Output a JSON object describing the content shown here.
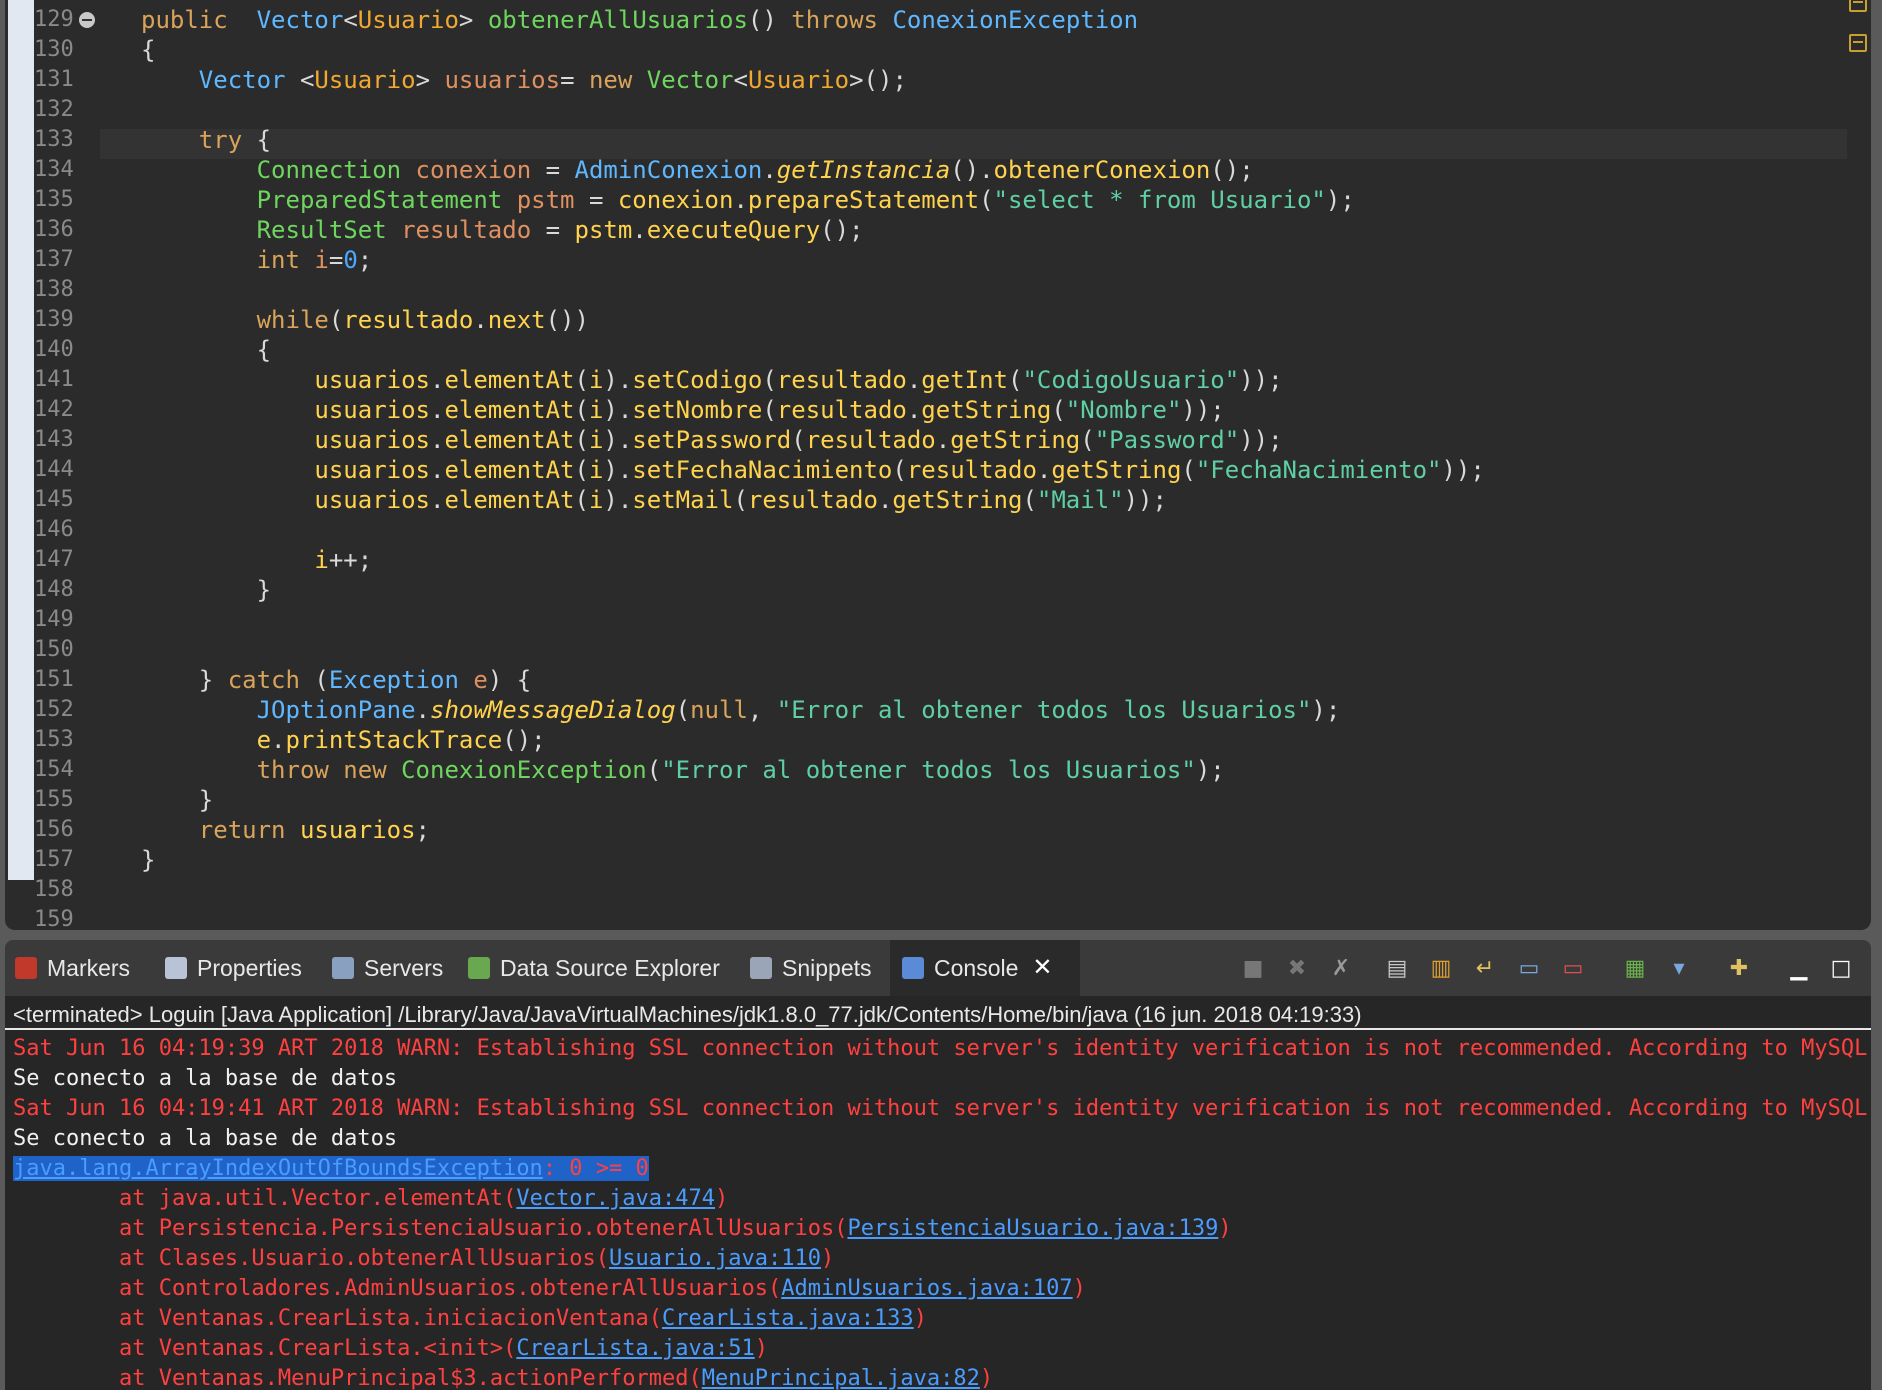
{
  "editor": {
    "line_numbers": [
      "129",
      "130",
      "131",
      "132",
      "133",
      "134",
      "135",
      "136",
      "137",
      "138",
      "139",
      "140",
      "141",
      "142",
      "143",
      "144",
      "145",
      "146",
      "147",
      "148",
      "149",
      "150",
      "151",
      "152",
      "153",
      "154",
      "155",
      "156",
      "157",
      "158",
      "159"
    ],
    "code": {
      "l129": {
        "t1": "public",
        "t2": "Vector",
        "t3": "<",
        "t4": "Usuario",
        "t5": ">",
        "t6": "obtenerAllUsuarios",
        "t7": "()",
        "t8": "throws",
        "t9": "ConexionException"
      },
      "l130": {
        "t1": "{"
      },
      "l131": {
        "t1": "Vector",
        "t2": "<",
        "t3": "Usuario",
        "t4": ">",
        "t5": "usuarios",
        "t6": "=",
        "t7": "new",
        "t8": "Vector",
        "t9": "<",
        "t10": "Usuario",
        "t11": ">();"
      },
      "l133": {
        "t1": "try",
        "t2": "{"
      },
      "l134": {
        "t1": "Connection",
        "t2": "conexion",
        "t3": "=",
        "t4": "AdminConexion",
        "t5": ".",
        "t6": "getInstancia",
        "t7": "().",
        "t8": "obtenerConexion",
        "t9": "();"
      },
      "l135": {
        "t1": "PreparedStatement",
        "t2": "pstm",
        "t3": "=",
        "t4": "conexion",
        "t5": ".",
        "t6": "prepareStatement",
        "t7": "(",
        "t8": "\"select * from Usuario\"",
        "t9": ");"
      },
      "l136": {
        "t1": "ResultSet",
        "t2": "resultado",
        "t3": "=",
        "t4": "pstm",
        "t5": ".",
        "t6": "executeQuery",
        "t7": "();"
      },
      "l137": {
        "t1": "int",
        "t2": "i",
        "t3": "=",
        "t4": "0",
        "t5": ";"
      },
      "l139": {
        "t1": "while",
        "t2": "(",
        "t3": "resultado",
        "t4": ".",
        "t5": "next",
        "t6": "())"
      },
      "l140": {
        "t1": "{"
      },
      "l141": {
        "t1": "usuarios",
        "t2": ".",
        "t3": "elementAt",
        "t4": "(",
        "t5": "i",
        "t6": ").",
        "t7": "setCodigo",
        "t8": "(",
        "t9": "resultado",
        "t10": ".",
        "t11": "getInt",
        "t12": "(",
        "t13": "\"CodigoUsuario\"",
        "t14": "));"
      },
      "l142": {
        "t1": "usuarios",
        "t2": ".",
        "t3": "elementAt",
        "t4": "(",
        "t5": "i",
        "t6": ").",
        "t7": "setNombre",
        "t8": "(",
        "t9": "resultado",
        "t10": ".",
        "t11": "getString",
        "t12": "(",
        "t13": "\"Nombre\"",
        "t14": "));"
      },
      "l143": {
        "t1": "usuarios",
        "t2": ".",
        "t3": "elementAt",
        "t4": "(",
        "t5": "i",
        "t6": ").",
        "t7": "setPassword",
        "t8": "(",
        "t9": "resultado",
        "t10": ".",
        "t11": "getString",
        "t12": "(",
        "t13": "\"Password\"",
        "t14": "));"
      },
      "l144": {
        "t1": "usuarios",
        "t2": ".",
        "t3": "elementAt",
        "t4": "(",
        "t5": "i",
        "t6": ").",
        "t7": "setFechaNacimiento",
        "t8": "(",
        "t9": "resultado",
        "t10": ".",
        "t11": "getString",
        "t12": "(",
        "t13": "\"FechaNacimiento\"",
        "t14": "));"
      },
      "l145": {
        "t1": "usuarios",
        "t2": ".",
        "t3": "elementAt",
        "t4": "(",
        "t5": "i",
        "t6": ").",
        "t7": "setMail",
        "t8": "(",
        "t9": "resultado",
        "t10": ".",
        "t11": "getString",
        "t12": "(",
        "t13": "\"Mail\"",
        "t14": "));"
      },
      "l147": {
        "t1": "i",
        "t2": "++;"
      },
      "l148": {
        "t1": "}"
      },
      "l151": {
        "t1": "}",
        "t2": "catch",
        "t3": "(",
        "t4": "Exception",
        "t5": "e",
        "t6": ")",
        "t7": "{"
      },
      "l152": {
        "t1": "JOptionPane",
        "t2": ".",
        "t3": "showMessageDialog",
        "t4": "(",
        "t5": "null",
        "t6": ",",
        "t7": "\"Error al obtener todos los Usuarios\"",
        "t8": ");"
      },
      "l153": {
        "t1": "e",
        "t2": ".",
        "t3": "printStackTrace",
        "t4": "();"
      },
      "l154": {
        "t1": "throw",
        "t2": "new",
        "t3": "ConexionException",
        "t4": "(",
        "t5": "\"Error al obtener todos los Usuarios\"",
        "t6": ");"
      },
      "l155": {
        "t1": "}"
      },
      "l156": {
        "t1": "return",
        "t2": "usuarios",
        "t3": ";"
      },
      "l157": {
        "t1": "}"
      }
    }
  },
  "tabs": {
    "markers": "Markers",
    "properties": "Properties",
    "servers": "Servers",
    "data_source_explorer": "Data Source Explorer",
    "snippets": "Snippets",
    "console": "Console"
  },
  "console": {
    "header": "<terminated> Loguin [Java Application] /Library/Java/JavaVirtualMachines/jdk1.8.0_77.jdk/Contents/Home/bin/java (16 jun. 2018 04:19:33)",
    "lines": [
      "Sat Jun 16 04:19:39 ART 2018 WARN: Establishing SSL connection without server's identity verification is not recommended. According to MySQL",
      "Se conecto a la base de datos",
      "Sat Jun 16 04:19:41 ART 2018 WARN: Establishing SSL connection without server's identity verification is not recommended. According to MySQL",
      "Se conecto a la base de datos"
    ],
    "exception": {
      "name": "java.lang.ArrayIndexOutOfBoundsException",
      "message": ": 0 >= 0"
    },
    "stack": [
      {
        "prefix": "        at java.util.Vector.elementAt(",
        "link": "Vector.java:474",
        "suffix": ")"
      },
      {
        "prefix": "        at Persistencia.PersistenciaUsuario.obtenerAllUsuarios(",
        "link": "PersistenciaUsuario.java:139",
        "suffix": ")"
      },
      {
        "prefix": "        at Clases.Usuario.obtenerAllUsuarios(",
        "link": "Usuario.java:110",
        "suffix": ")"
      },
      {
        "prefix": "        at Controladores.AdminUsuarios.obtenerAllUsuarios(",
        "link": "AdminUsuarios.java:107",
        "suffix": ")"
      },
      {
        "prefix": "        at Ventanas.CrearLista.iniciacionVentana(",
        "link": "CrearLista.java:133",
        "suffix": ")"
      },
      {
        "prefix": "        at Ventanas.CrearLista.<init>(",
        "link": "CrearLista.java:51",
        "suffix": ")"
      },
      {
        "prefix": "        at Ventanas.MenuPrincipal$3.actionPerformed(",
        "link": "MenuPrincipal.java:82",
        "suffix": ")"
      }
    ]
  }
}
